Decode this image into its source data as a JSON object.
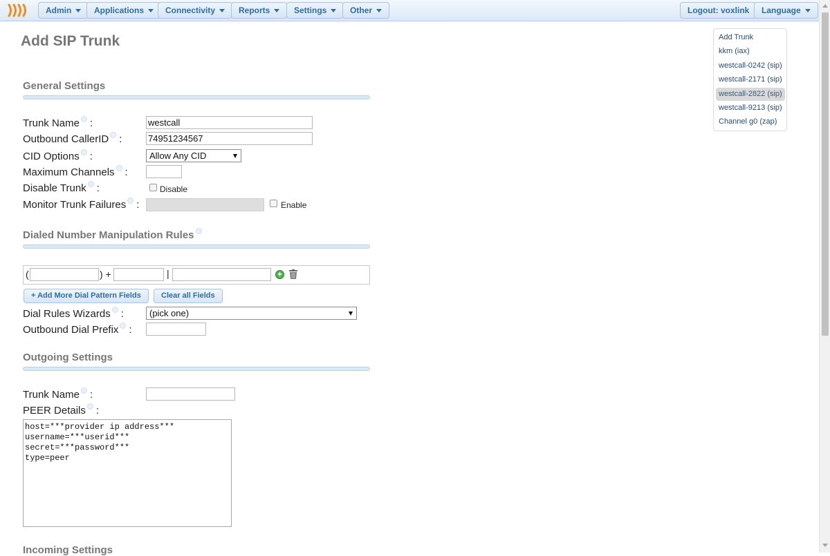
{
  "nav": {
    "items": [
      {
        "label": "Admin"
      },
      {
        "label": "Applications"
      },
      {
        "label": "Connectivity"
      },
      {
        "label": "Reports"
      },
      {
        "label": "Settings"
      },
      {
        "label": "Other"
      }
    ],
    "logout": "Logout: voxlink",
    "language": "Language",
    "accent_color": "#2e6e9e"
  },
  "page": {
    "title": "Add SIP Trunk"
  },
  "general": {
    "title": "General Settings",
    "trunk_name_label": "Trunk Name",
    "trunk_name_value": "westcall",
    "callerid_label": "Outbound CallerID",
    "callerid_value": "74951234567",
    "cid_options_label": "CID Options",
    "cid_options_value": "Allow Any CID",
    "max_channels_label": "Maximum Channels",
    "max_channels_value": "",
    "disable_label": "Disable Trunk",
    "disable_check_label": "Disable",
    "monitor_label": "Monitor Trunk Failures",
    "monitor_check_label": "Enable"
  },
  "dialrules": {
    "title": "Dialed Number Manipulation Rules",
    "open_paren": "(",
    "close_plus": ") +",
    "pipe": "|",
    "add_more_button": "+ Add More Dial Pattern Fields",
    "clear_button": "Clear all Fields",
    "wizard_label": "Dial Rules Wizards",
    "wizard_value": "(pick one)",
    "prefix_label": "Outbound Dial Prefix"
  },
  "outgoing": {
    "title": "Outgoing Settings",
    "trunk_name_label": "Trunk Name",
    "peer_label": "PEER Details",
    "peer_value": "host=***provider ip address***\nusername=***userid***\nsecret=***password***\ntype=peer"
  },
  "incoming": {
    "title": "Incoming Settings"
  },
  "trunks": {
    "items": [
      {
        "label": "Add Trunk"
      },
      {
        "label": "kkm (iax)"
      },
      {
        "label": "westcall-0242 (sip)"
      },
      {
        "label": "westcall-2171 (sip)"
      },
      {
        "label": "westcall-2822 (sip)",
        "active": true
      },
      {
        "label": "westcall-9213 (sip)"
      },
      {
        "label": "Channel g0 (zap)"
      }
    ]
  }
}
